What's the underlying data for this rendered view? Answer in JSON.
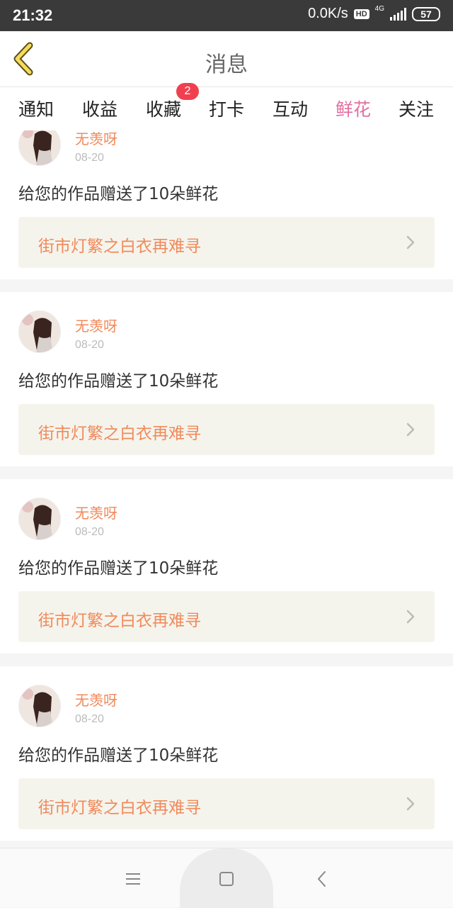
{
  "status_bar": {
    "time": "21:32",
    "network_speed": "0.0K/s",
    "hd": "HD",
    "net_type": "4G",
    "battery": "57"
  },
  "header": {
    "title": "消息",
    "back_icon": "chevron-left-icon"
  },
  "tabs": [
    {
      "label": "通知"
    },
    {
      "label": "收益"
    },
    {
      "label": "收藏",
      "badge": "2"
    },
    {
      "label": "打卡"
    },
    {
      "label": "互动"
    },
    {
      "label": "鲜花",
      "active": true
    },
    {
      "label": "关注"
    }
  ],
  "colors": {
    "accent_pink": "#e070a0",
    "accent_orange": "#f08a5c",
    "badge_red": "#f04050",
    "card_link_bg": "#f5f4ec"
  },
  "feed": [
    {
      "username": "无羡呀",
      "date": "08-20",
      "message": "给您的作品赠送了10朵鲜花",
      "work_title": "街市灯繁之白衣再难寻"
    },
    {
      "username": "无羡呀",
      "date": "08-20",
      "message": "给您的作品赠送了10朵鲜花",
      "work_title": "街市灯繁之白衣再难寻"
    },
    {
      "username": "无羡呀",
      "date": "08-20",
      "message": "给您的作品赠送了10朵鲜花",
      "work_title": "街市灯繁之白衣再难寻"
    },
    {
      "username": "无羡呀",
      "date": "08-20",
      "message": "给您的作品赠送了10朵鲜花",
      "work_title": "街市灯繁之白衣再难寻"
    }
  ],
  "nav_bar": {
    "icons": [
      "menu-icon",
      "home-square-icon",
      "back-triangle-icon"
    ]
  }
}
